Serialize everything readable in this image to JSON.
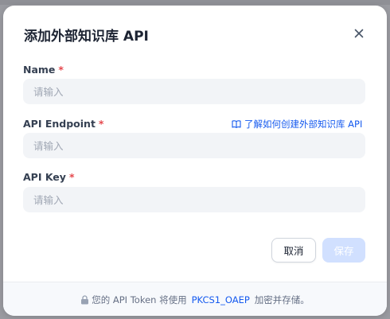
{
  "dialog": {
    "title": "添加外部知识库 API",
    "close_icon": "close-icon"
  },
  "form": {
    "name": {
      "label": "Name",
      "required_mark": "*",
      "placeholder": "请输入",
      "value": ""
    },
    "endpoint": {
      "label": "API Endpoint",
      "required_mark": "*",
      "placeholder": "请输入",
      "value": "",
      "help_link": "了解如何创建外部知识库 API",
      "help_icon": "book-icon"
    },
    "api_key": {
      "label": "API Key",
      "required_mark": "*",
      "placeholder": "请输入",
      "value": ""
    }
  },
  "actions": {
    "cancel_label": "取消",
    "save_label": "保存"
  },
  "footer": {
    "lock_icon": "lock-icon",
    "text_before": "您的 API Token 将使用",
    "encryption": "PKCS1_OAEP",
    "text_after": "加密并存储。"
  },
  "colors": {
    "accent": "#155aef",
    "required": "#e5484d",
    "save_disabled_bg": "#d1e0ff",
    "input_bg": "#f2f4f7"
  }
}
